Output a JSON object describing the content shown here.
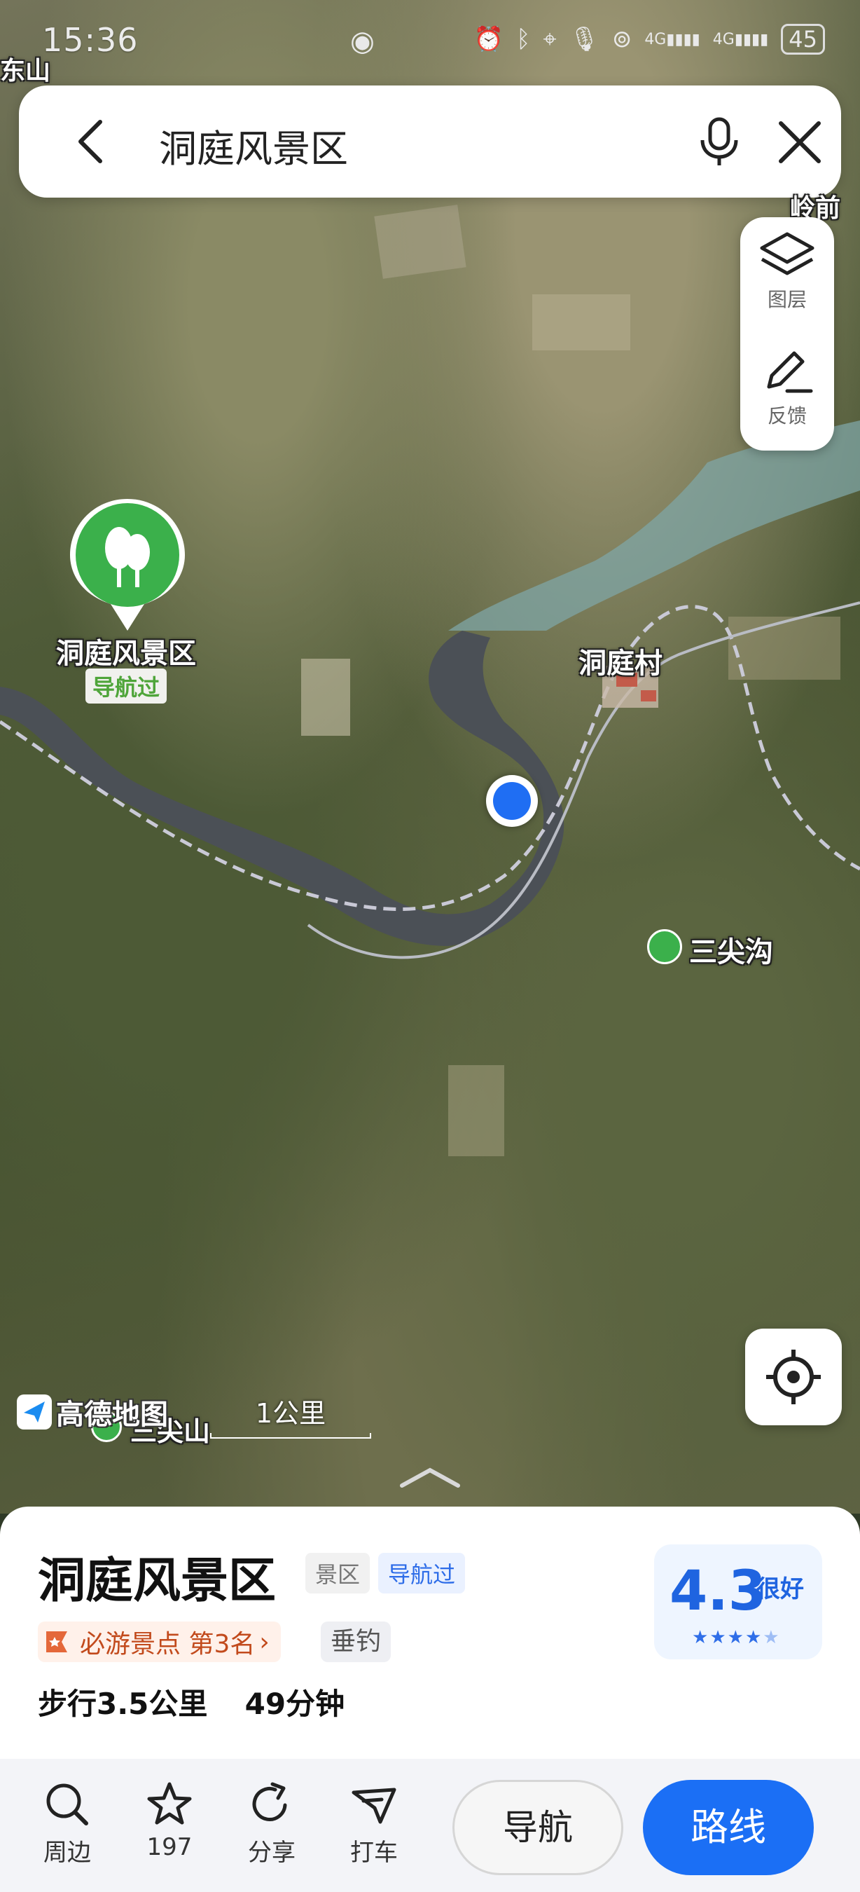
{
  "status": {
    "time": "15:36",
    "battery": "45",
    "signal": "4G"
  },
  "search": {
    "query": "洞庭风景区"
  },
  "side_panel": {
    "layers_label": "图层",
    "feedback_label": "反馈"
  },
  "map": {
    "labels": {
      "top_left": "东山",
      "top_right": "岭前",
      "village": "洞庭村",
      "sanjiangou": "三尖沟",
      "bottom_peak": "三尖山",
      "poi_name": "洞庭风景区",
      "poi_tag": "导航过"
    },
    "logo": "高德地图",
    "scale": "1公里"
  },
  "place": {
    "title": "洞庭风景区",
    "type_tag": "景区",
    "nav_tag": "导航过",
    "rating": "4.3",
    "rating_word": "很好",
    "stars": 4.3,
    "rank_text": "必游景点 第3名",
    "extra_tag": "垂钓",
    "walk_distance": "步行3.5公里",
    "walk_time": "49分钟"
  },
  "toolbar": {
    "nearby": "周边",
    "favorites_count": "197",
    "share": "分享",
    "taxi": "打车",
    "navigate": "导航",
    "route": "路线"
  },
  "colors": {
    "accent": "#1b6ff5",
    "poi_green": "#3bb04b",
    "rating_blue": "#1f64e0"
  }
}
